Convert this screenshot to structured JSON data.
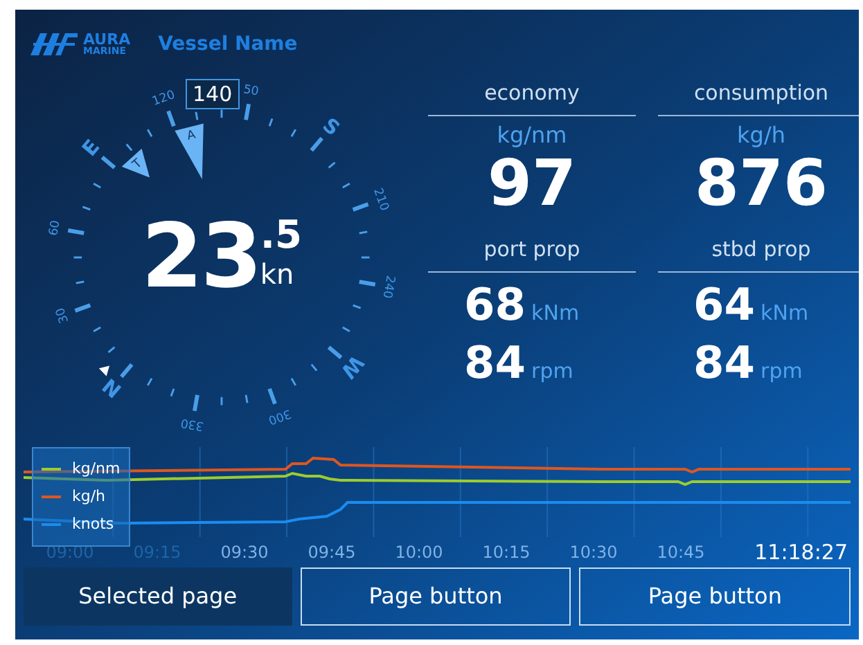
{
  "header": {
    "logo_top": "AURA",
    "logo_bottom": "MARINE",
    "vessel_name": "Vessel Name"
  },
  "compass": {
    "heading": "140",
    "labels": [
      "120",
      "50",
      "S",
      "210",
      "240",
      "W",
      "300",
      "330",
      "N",
      "30",
      "60",
      "E"
    ],
    "markers": [
      {
        "kind": "true",
        "label": "T"
      },
      {
        "kind": "apparent",
        "label": "A"
      }
    ],
    "speed": {
      "whole": "23",
      "decimal": ".5",
      "unit": "kn"
    }
  },
  "gauges": [
    {
      "title": "economy",
      "kind": "single",
      "unit": "kg/nm",
      "value": "97"
    },
    {
      "title": "consumption",
      "kind": "single",
      "unit": "kg/h",
      "value": "876"
    },
    {
      "title": "port prop",
      "kind": "dual",
      "readings": [
        {
          "value": "68",
          "unit": "kNm"
        },
        {
          "value": "84",
          "unit": "rpm"
        }
      ]
    },
    {
      "title": "stbd prop",
      "kind": "dual",
      "readings": [
        {
          "value": "64",
          "unit": "kNm"
        },
        {
          "value": "84",
          "unit": "rpm"
        }
      ]
    }
  ],
  "trend": {
    "legend": [
      {
        "label": "kg/nm",
        "color": "#9ccc2e"
      },
      {
        "label": "kg/h",
        "color": "#e0561e"
      },
      {
        "label": "knots",
        "color": "#1a8cf0"
      }
    ],
    "time_labels": [
      "09:00",
      "09:15",
      "09:30",
      "09:45",
      "10:00",
      "10:15",
      "10:30",
      "10:45"
    ],
    "clock": "11:18:27"
  },
  "page_buttons": [
    {
      "label": "Selected page",
      "selected": true
    },
    {
      "label": "Page button",
      "selected": false
    },
    {
      "label": "Page button",
      "selected": false
    }
  ]
}
